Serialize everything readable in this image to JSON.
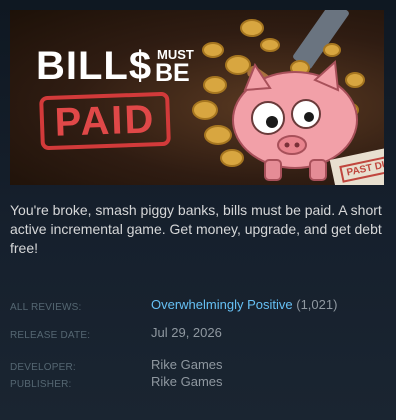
{
  "capsule": {
    "logo_bills": "BILL$",
    "logo_must": "MUST",
    "logo_be": "BE",
    "logo_paid": "PAID",
    "stamp_text": "PAST DU"
  },
  "description": "You're broke, smash piggy banks, bills must be paid. A short active incremental game. Get money, upgrade, and get debt free!",
  "reviews": {
    "label": "ALL REVIEWS:",
    "summary": "Overwhelmingly Positive",
    "count": "(1,021)"
  },
  "release": {
    "label": "RELEASE DATE:",
    "date": "Jul 29, 2026"
  },
  "developer": {
    "label": "DEVELOPER:",
    "name": "Rike Games"
  },
  "publisher": {
    "label": "PUBLISHER:",
    "name": "Rike Games"
  },
  "colors": {
    "background": "#1b2838",
    "link": "#66c0f4",
    "label": "#556772",
    "text": "#d6d7d8",
    "logo_red": "#d23a3a",
    "pig_pink": "#f2a0a8",
    "coin_gold": "#d8a640"
  }
}
